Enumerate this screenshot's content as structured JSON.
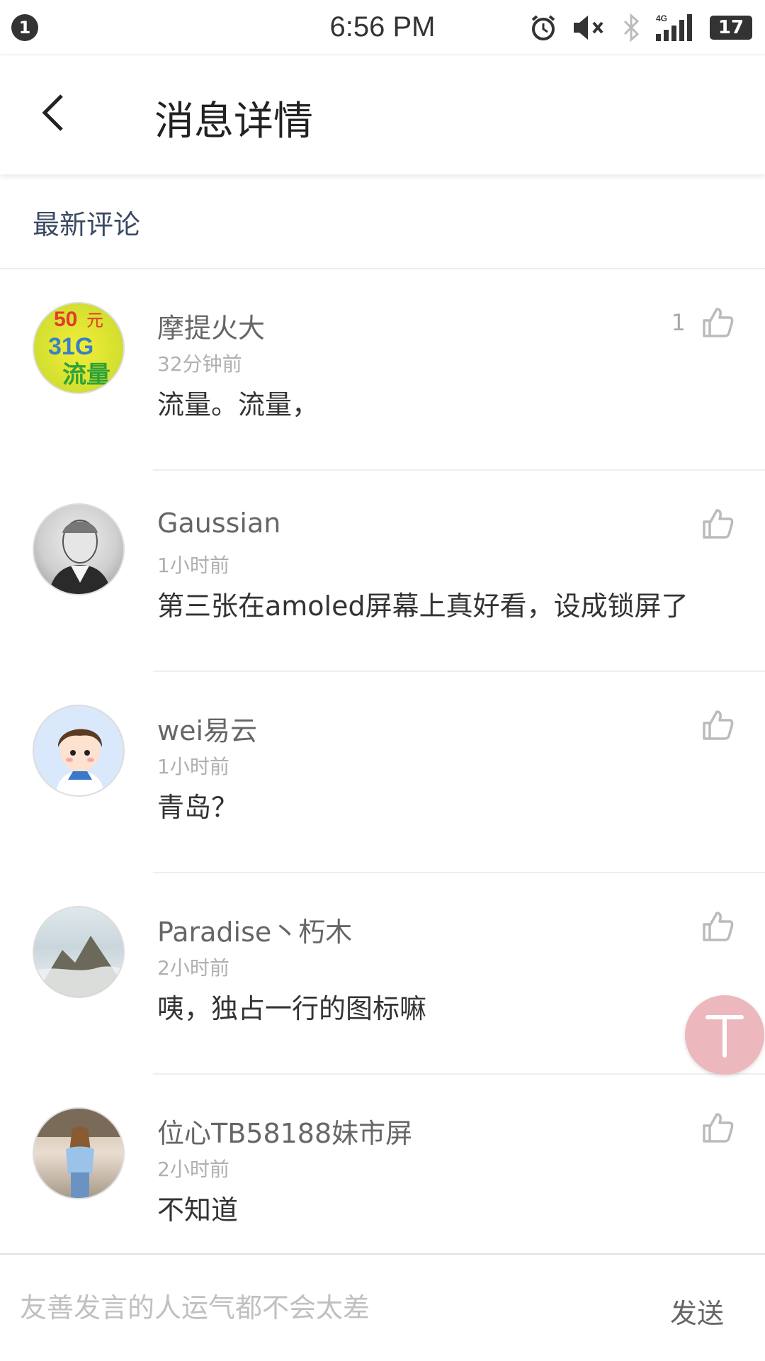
{
  "status_bar": {
    "notification_count": "1",
    "time": "6:56 PM",
    "network": "4G",
    "battery": "17",
    "icons": [
      "alarm-icon",
      "mute-icon",
      "bluetooth-icon",
      "signal-icon",
      "battery-icon"
    ]
  },
  "header": {
    "title": "消息详情",
    "back_icon": "chevron-left-icon"
  },
  "section": {
    "label": "最新评论"
  },
  "comments": [
    {
      "name": "摩提火大",
      "time": "32分钟前",
      "text": "流量。流量，",
      "likes": "1",
      "avatar": "ad-banner-avatar"
    },
    {
      "name": "Gaussian",
      "time": "1小时前",
      "text": "第三张在amoled屏幕上真好看，设成锁屏了",
      "likes": "",
      "avatar": "portrait-engraving-avatar"
    },
    {
      "name": "wei易云",
      "time": "1小时前",
      "text": "青岛？",
      "likes": "",
      "avatar": "cartoon-boy-avatar"
    },
    {
      "name": "Paradise丶朽木",
      "time": "2小时前",
      "text": "咦，独占一行的图标嘛",
      "likes": "",
      "avatar": "mountain-avatar"
    },
    {
      "name": "位心TB58188妹市屏",
      "time": "2小时前",
      "text": "不知道",
      "likes": "",
      "avatar": "woman-photo-avatar"
    }
  ],
  "input": {
    "placeholder": "友善发言的人运气都不会太差",
    "send_label": "发送"
  },
  "colors": {
    "section_label": "#3b4a63",
    "float_button": "#ecb7bd"
  }
}
